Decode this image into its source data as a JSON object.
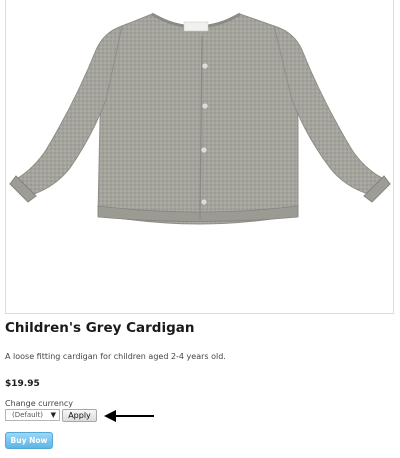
{
  "product": {
    "image_alt": "Children's grey knitted cardigan",
    "title": "Children's Grey Cardigan",
    "description": "A loose fitting cardigan for children aged 2-4 years old.",
    "price": "$19.95"
  },
  "currency": {
    "label": "Change currency",
    "selected": "(Default)",
    "dropdown_icon": "triangle-down",
    "apply_label": "Apply"
  },
  "actions": {
    "buy_label": "Buy Now",
    "buy_color": "#6fc1ec"
  },
  "colors": {
    "cardigan_grey": "#a3a39c",
    "accent_blue": "#5bb6e6"
  }
}
